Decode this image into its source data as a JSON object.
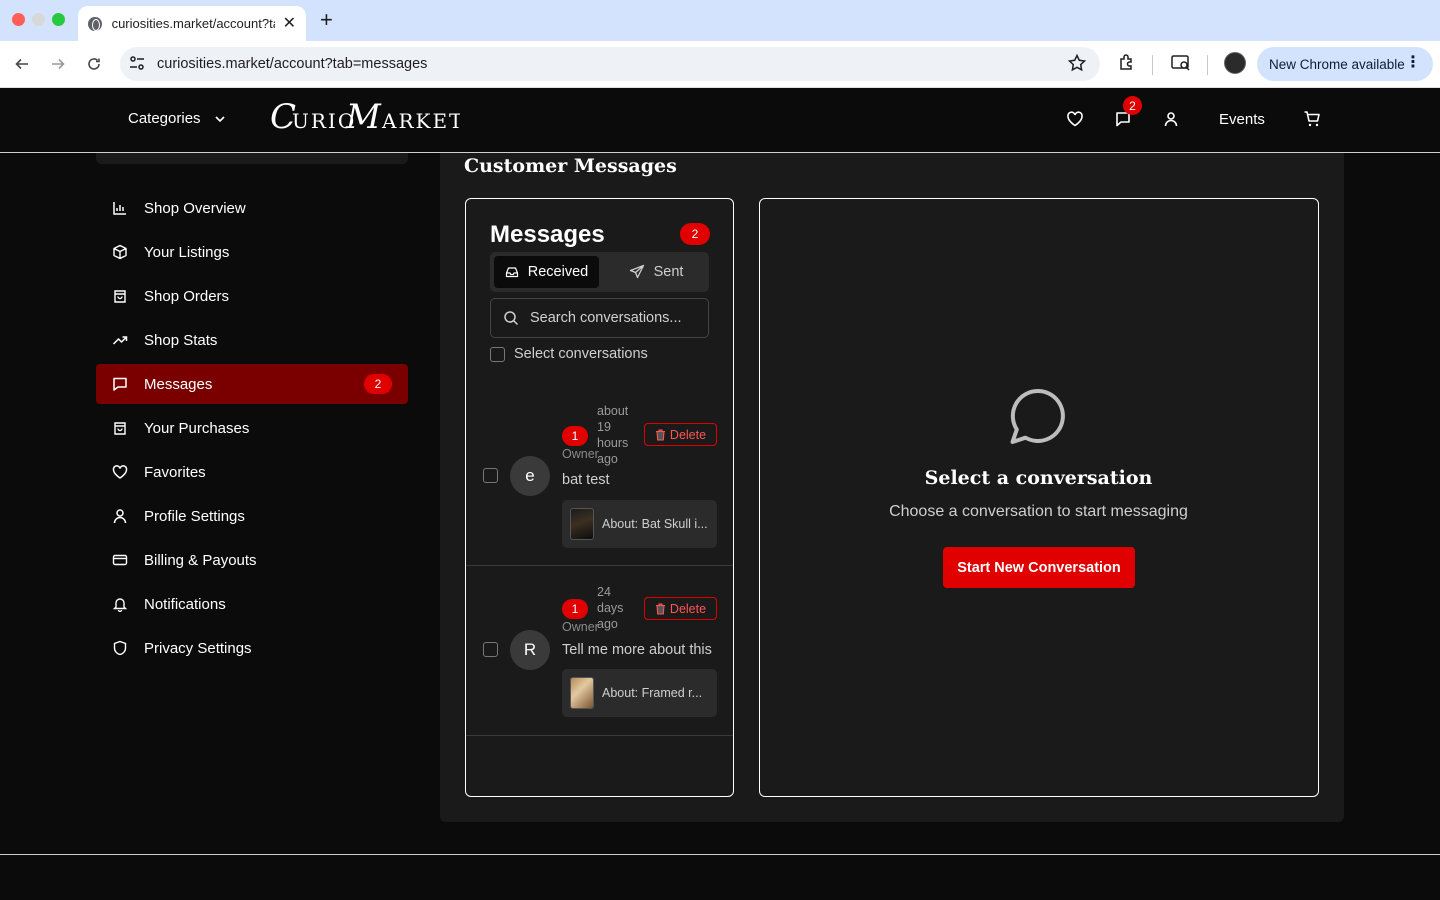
{
  "browser": {
    "tab_title": "curiosities.market/account?ta",
    "url": "curiosities.market/account?tab=messages",
    "update_label": "New Chrome available"
  },
  "header": {
    "categories_label": "Categories",
    "logo_text": "Curio Market",
    "message_badge": "2",
    "events_label": "Events"
  },
  "sidebar": {
    "items": [
      {
        "label": "Shop Overview",
        "icon": "bar-chart-icon"
      },
      {
        "label": "Your Listings",
        "icon": "package-icon"
      },
      {
        "label": "Shop Orders",
        "icon": "shopping-bag-icon"
      },
      {
        "label": "Shop Stats",
        "icon": "trending-up-icon"
      },
      {
        "label": "Messages",
        "icon": "message-square-icon",
        "badge": "2",
        "active": true
      },
      {
        "label": "Your Purchases",
        "icon": "shopping-bag-icon"
      },
      {
        "label": "Favorites",
        "icon": "heart-icon"
      },
      {
        "label": "Profile Settings",
        "icon": "user-icon"
      },
      {
        "label": "Billing & Payouts",
        "icon": "credit-card-icon"
      },
      {
        "label": "Notifications",
        "icon": "bell-icon"
      },
      {
        "label": "Privacy Settings",
        "icon": "shield-icon"
      }
    ]
  },
  "main": {
    "title": "Customer Messages",
    "messages": {
      "heading": "Messages",
      "count": "2",
      "tab_received": "Received",
      "tab_sent": "Sent",
      "search_placeholder": "Search conversations...",
      "select_label": "Select conversations",
      "conversations": [
        {
          "avatar": "e",
          "unread": "1",
          "role": "Owner",
          "time": "about 19 hours ago",
          "delete_label": "Delete",
          "preview": "bat test",
          "about": "About: Bat Skull i..."
        },
        {
          "avatar": "R",
          "unread": "1",
          "role": "Owner",
          "time": "24 days ago",
          "delete_label": "Delete",
          "preview": "Tell me more about this",
          "about": "About: Framed r..."
        }
      ]
    },
    "empty_state": {
      "title": "Select a conversation",
      "subtitle": "Choose a conversation to start messaging",
      "button_label": "Start New Conversation"
    }
  },
  "colors": {
    "accent": "#e00000",
    "active_sidebar": "#7a0000",
    "background": "#0b0b0b",
    "panel": "#1a1a1a"
  }
}
